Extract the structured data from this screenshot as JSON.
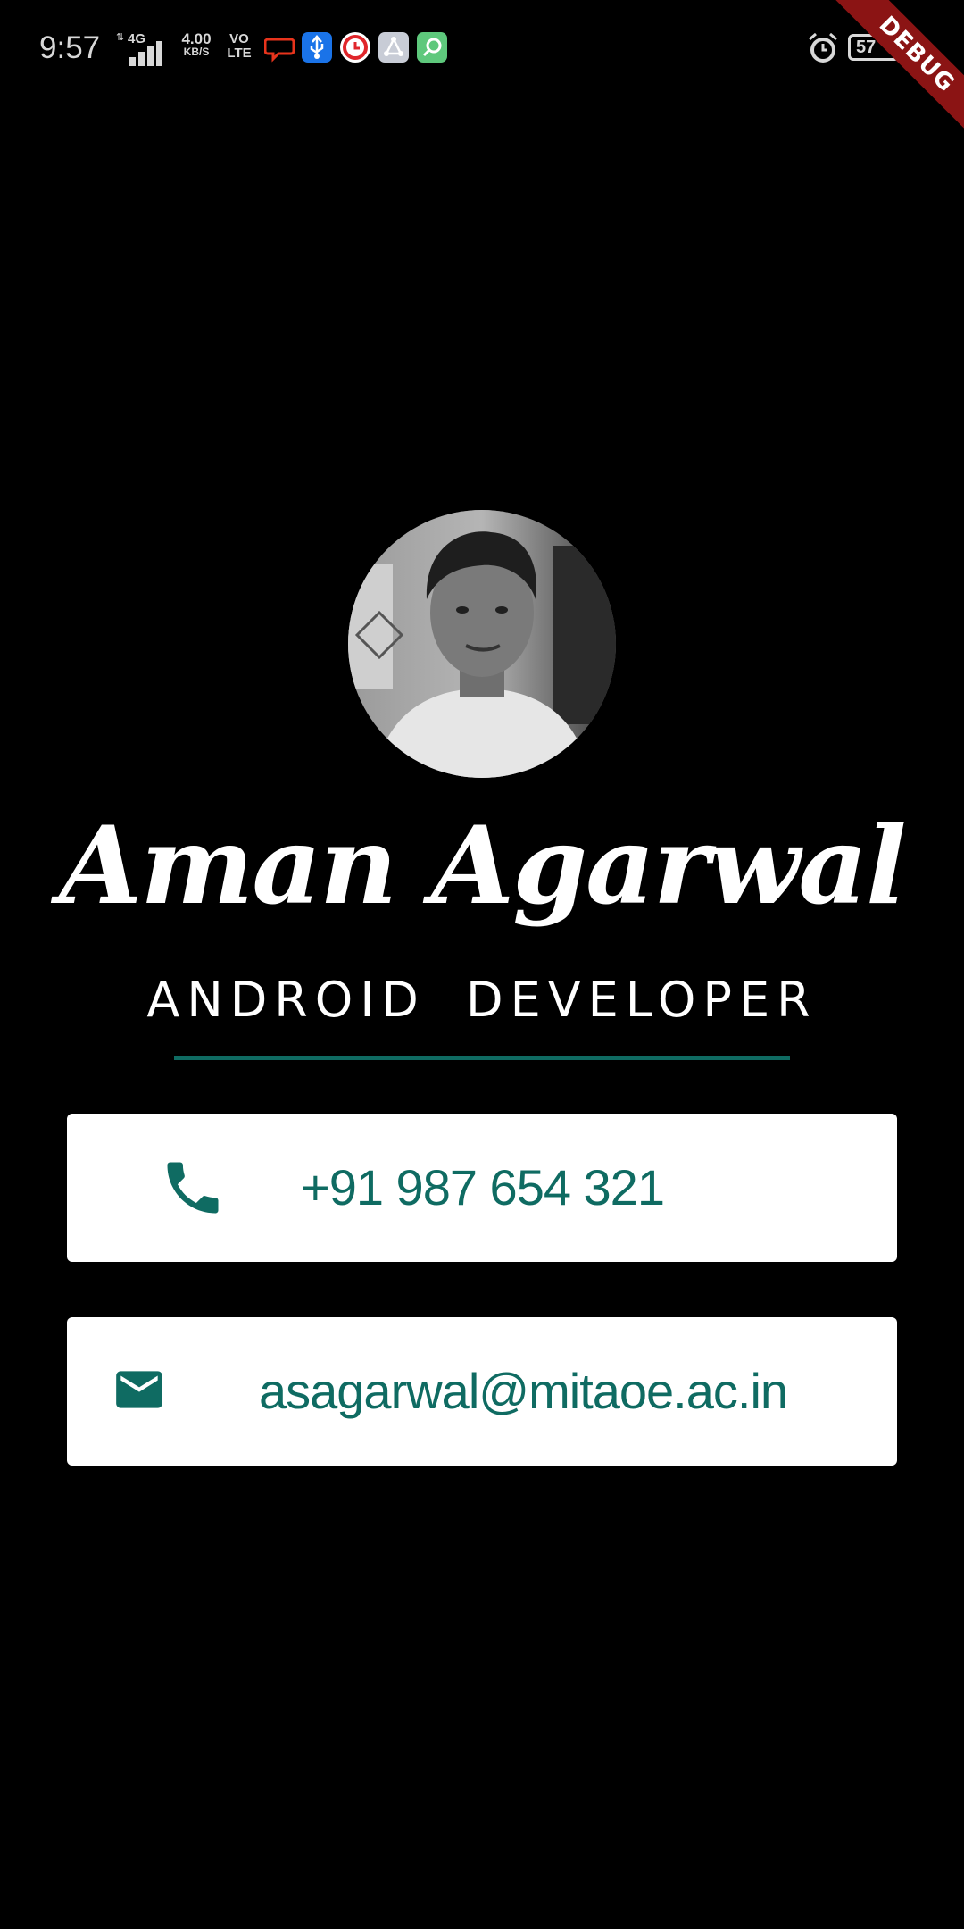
{
  "status_bar": {
    "time": "9:57",
    "network_type": "4G",
    "speed_value": "4.00",
    "speed_unit": "KB/S",
    "volte_top": "VO",
    "volte_bottom": "LTE",
    "battery": "57"
  },
  "debug_banner": "DEBUG",
  "profile": {
    "name": "Aman Agarwal",
    "title": "ANDROID DEVELOPER"
  },
  "contacts": {
    "phone": "+91 987 654 321",
    "email": "asagarwal@mitaoe.ac.in"
  },
  "colors": {
    "background": "#000000",
    "accent": "#0f6b62",
    "card": "#ffffff",
    "debug": "#8b1414"
  }
}
